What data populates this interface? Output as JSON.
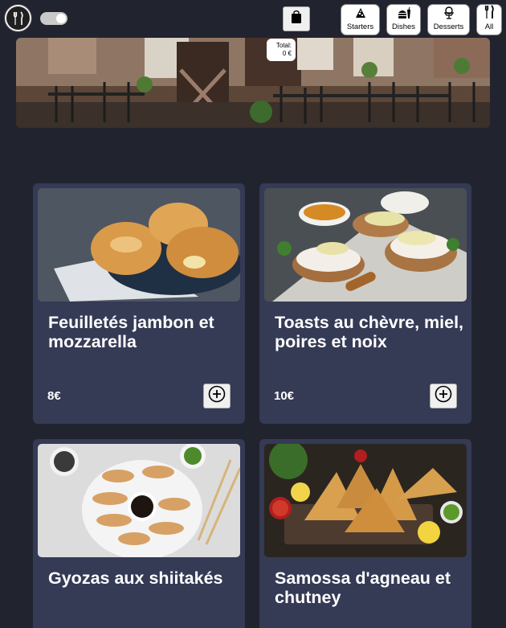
{
  "header": {
    "logo_icon": "fork-knife-icon",
    "cart_icon": "shopping-bag-icon",
    "total_label": "Total:",
    "total_value": "0 €"
  },
  "nav": [
    {
      "label": "Starters",
      "icon": "pizza-slice-icon"
    },
    {
      "label": "Dishes",
      "icon": "burger-drink-icon"
    },
    {
      "label": "Desserts",
      "icon": "ice-cream-icon"
    },
    {
      "label": "All",
      "icon": "fork-knife-icon"
    }
  ],
  "products": [
    {
      "name": "Feuilletés jambon et mozzarella",
      "price": "8€"
    },
    {
      "name": "Toasts au chèvre, miel, poires et noix",
      "price": "10€"
    },
    {
      "name": "Gyozas aux shiitakés",
      "price": ""
    },
    {
      "name": "Samossa d'agneau et chutney",
      "price": ""
    }
  ],
  "colors": {
    "background": "#21232f",
    "card": "#353a55",
    "button": "#f0f0f0"
  }
}
